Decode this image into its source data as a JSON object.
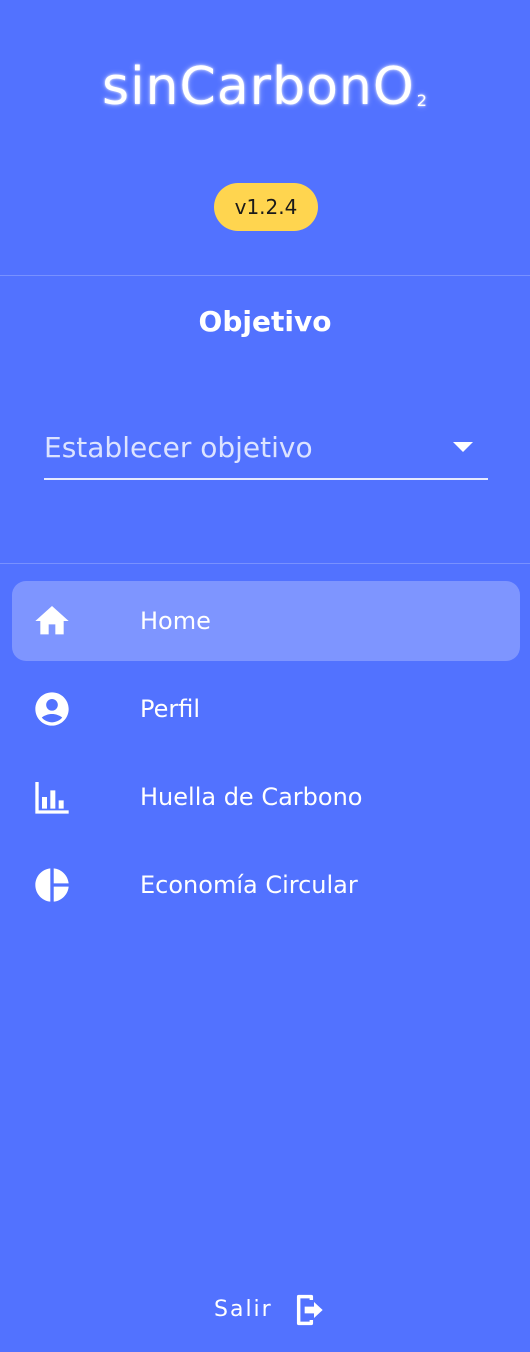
{
  "app": {
    "logo_text": "sinCarbonO",
    "logo_subscript": "2",
    "version": "v1.2.4"
  },
  "goal": {
    "title": "Objetivo",
    "select_placeholder": "Establecer objetivo"
  },
  "nav": {
    "items": [
      {
        "label": "Home",
        "icon": "home-icon",
        "active": true
      },
      {
        "label": "Perfil",
        "icon": "account-circle-icon",
        "active": false
      },
      {
        "label": "Huella de Carbono",
        "icon": "bar-chart-icon",
        "active": false
      },
      {
        "label": "Economía Circular",
        "icon": "pie-chart-icon",
        "active": false
      }
    ]
  },
  "footer": {
    "logout_label": "Salir",
    "logout_icon": "logout-icon"
  },
  "colors": {
    "background": "#5272FF",
    "active_item": "#7E95FF",
    "version_badge": "#FFD54F",
    "text": "#FFFFFF"
  }
}
